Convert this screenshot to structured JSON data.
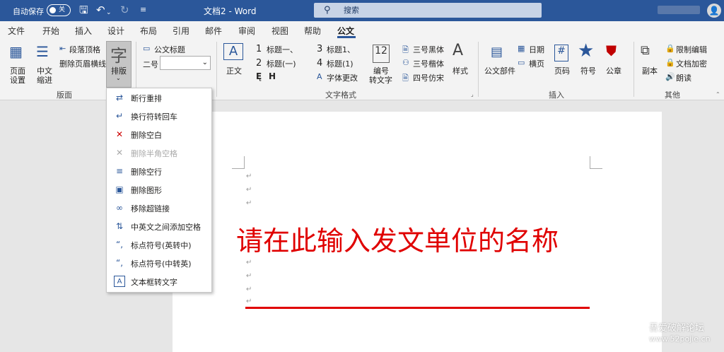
{
  "titlebar": {
    "autosave_label": "自动保存",
    "autosave_state": "关",
    "doc_title": "文档2 - Word",
    "search_placeholder": "搜索"
  },
  "tabs": [
    "文件",
    "开始",
    "插入",
    "设计",
    "布局",
    "引用",
    "邮件",
    "审阅",
    "视图",
    "帮助",
    "公文"
  ],
  "active_tab": "公文",
  "ribbon": {
    "layout_group": {
      "label": "版面",
      "page_setup": [
        "页面",
        "设置"
      ],
      "cn_indent": [
        "中文",
        "缩进"
      ],
      "para_top": "段落顶格",
      "del_header_line": "删除页眉横线",
      "typeset_icon_char": "字",
      "typeset": "排版"
    },
    "title_group": {
      "doc_title": "公文标题",
      "size_label": "二号"
    },
    "text_format_group": {
      "label": "文字格式",
      "body": "正文",
      "h1": "标题一、",
      "h2": "标题(一)",
      "h3": "标题1、",
      "h4": "标题(1)",
      "num1": "1",
      "num2": "2",
      "num3": "3",
      "num4": "4",
      "font_change": "字体更改",
      "number_to_text": [
        "编号",
        "转文字"
      ],
      "font_heiti": "三号黑体",
      "font_kaiti": "三号楷体",
      "font_fangsong": "四号仿宋",
      "style": "样式"
    },
    "insert_group": {
      "label": "插入",
      "doc_parts": "公文部件",
      "date": "日期",
      "horizontal_page": "横页",
      "page_num": "页码",
      "symbol": "符号",
      "seal": "公章"
    },
    "other_group": {
      "label": "其他",
      "copy": "副本",
      "restrict_edit": "限制编辑",
      "encrypt": "文档加密",
      "read_aloud": "朗读"
    }
  },
  "menu_items": [
    {
      "label": "断行重排",
      "icon": "⇄",
      "disabled": false
    },
    {
      "label": "换行符转回车",
      "icon": "↵",
      "disabled": false
    },
    {
      "label": "删除空白",
      "icon": "✕",
      "disabled": false
    },
    {
      "label": "删除半角空格",
      "icon": "✕",
      "disabled": true
    },
    {
      "label": "删除空行",
      "icon": "≡",
      "disabled": false
    },
    {
      "label": "删除图形",
      "icon": "▣",
      "disabled": false
    },
    {
      "label": "移除超链接",
      "icon": "∞",
      "disabled": false
    },
    {
      "label": "中英文之间添加空格",
      "icon": "⇅",
      "disabled": false
    },
    {
      "label": "标点符号(英转中)",
      "icon": "“,",
      "disabled": false
    },
    {
      "label": "标点符号(中转英)",
      "icon": "“,",
      "disabled": false
    },
    {
      "label": "文本框转文字",
      "icon": "A",
      "disabled": false
    }
  ],
  "document": {
    "heading_text": "请在此输入发文单位的名称",
    "para_mark": "↵"
  },
  "watermark": {
    "line1": "吾爱破解论坛",
    "line2": "www.52pojie.cn"
  },
  "colors": {
    "titlebar": "#2b579a",
    "accent_red": "#e00000"
  }
}
